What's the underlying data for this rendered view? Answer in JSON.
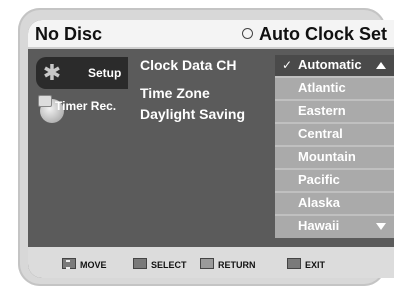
{
  "header": {
    "title": "No Disc",
    "setting_name": "Auto Clock Set"
  },
  "sidebar": {
    "items": [
      {
        "label": "Setup",
        "icon": "gear-icon",
        "active": true
      },
      {
        "label": "Timer Rec.",
        "icon": "timer-record-icon",
        "active": false
      }
    ]
  },
  "menu": {
    "items": [
      {
        "label": "Clock Data CH"
      },
      {
        "label": "Time Zone"
      },
      {
        "label": "Daylight Saving"
      }
    ]
  },
  "dropdown": {
    "selected": "Automatic",
    "options": [
      "Automatic",
      "Atlantic",
      "Eastern",
      "Central",
      "Mountain",
      "Pacific",
      "Alaska",
      "Hawaii"
    ]
  },
  "footer": {
    "move": "MOVE",
    "select": "SELECT",
    "return": "RETURN",
    "exit": "EXIT"
  },
  "colors": {
    "panel": "#5b5b5b",
    "active_tab": "#2b2b2b",
    "dropdown": "#aaaaaa",
    "selected_option": "#4a4a4a"
  }
}
